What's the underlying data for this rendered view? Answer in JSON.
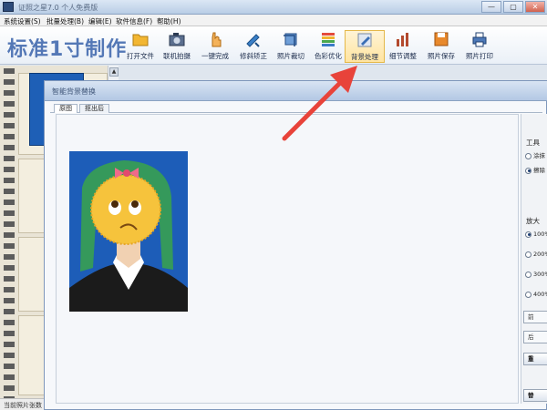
{
  "window": {
    "title": "证照之星7.0 个人免费版",
    "controls": [
      "—",
      "▢",
      "✕"
    ]
  },
  "menu": [
    "系统设置(S)",
    "批量处理(B)",
    "编辑(E)",
    "软件信息(F)",
    "帮助(H)"
  ],
  "brand": "标准1寸制作",
  "toolbar": [
    {
      "label": "打开文件",
      "icon": "folder-icon"
    },
    {
      "label": "联机拍摄",
      "icon": "camera-icon"
    },
    {
      "label": "一键完成",
      "icon": "hand-icon"
    },
    {
      "label": "修斜矫正",
      "icon": "tools-icon"
    },
    {
      "label": "照片裁切",
      "icon": "crop-icon"
    },
    {
      "label": "色彩优化",
      "icon": "color-bars-icon"
    },
    {
      "label": "背景处理",
      "icon": "brush-icon"
    },
    {
      "label": "细节调整",
      "icon": "chart-icon"
    },
    {
      "label": "照片保存",
      "icon": "save-icon"
    },
    {
      "label": "照片打印",
      "icon": "printer-icon"
    }
  ],
  "dialog": {
    "title": "智能背景替换",
    "tabs": [
      "原图",
      "抠出后"
    ]
  },
  "panel": {
    "tool_label": "工具",
    "tools": [
      "涂抹",
      "擦除"
    ],
    "zoom_label": "放大",
    "zooms": [
      "100%",
      "200%",
      "300%",
      "400%"
    ],
    "buttons": [
      "前",
      "后",
      "重"
    ],
    "bottom_button": "替"
  },
  "status": {
    "text": "当前照片张数"
  },
  "colors": {
    "accent": "#5478b6",
    "photo_bg": "#1d5db8",
    "arrow": "#e8433a"
  }
}
